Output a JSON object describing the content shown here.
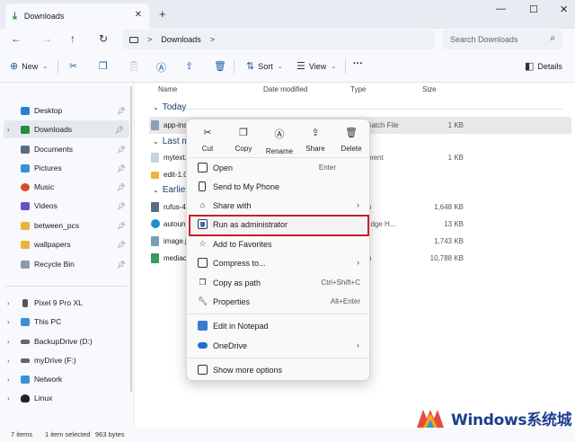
{
  "window": {
    "tab_title": "Downloads",
    "new_tab_glyph": "+",
    "controls": {
      "minimize": "—",
      "maximize": "☐",
      "close": "✕"
    }
  },
  "address": {
    "path": "Downloads",
    "search_placeholder": "Search Downloads"
  },
  "commandbar": {
    "new_label": "New",
    "sort_label": "Sort",
    "view_label": "View",
    "more_glyph": "···",
    "details_label": "Details"
  },
  "sidebar": {
    "quick_access": [
      {
        "label": "Desktop",
        "color": "#2d7dd2"
      },
      {
        "label": "Downloads",
        "color": "#2a8a3a"
      },
      {
        "label": "Documents",
        "color": "#5a6b82"
      },
      {
        "label": "Pictures",
        "color": "#3b8fd9"
      },
      {
        "label": "Music",
        "color": "#d84a2c"
      },
      {
        "label": "Videos",
        "color": "#6b4fc9"
      },
      {
        "label": "between_pcs",
        "color": "#e8b53a"
      },
      {
        "label": "wallpapers",
        "color": "#e8b53a"
      },
      {
        "label": "Recycle Bin",
        "color": "#8a9aab"
      }
    ],
    "devices": [
      {
        "label": "Pixel 9 Pro XL",
        "color": "#555555"
      },
      {
        "label": "This PC",
        "color": "#3b8fd9"
      },
      {
        "label": "BackupDrive (D:)",
        "color": "#666666"
      },
      {
        "label": "myDrive (F:)",
        "color": "#666666"
      },
      {
        "label": "Network",
        "color": "#3b8fd9"
      },
      {
        "label": "Linux",
        "color": "#222222"
      }
    ]
  },
  "filelist": {
    "columns": {
      "name": "Name",
      "date": "Date modified",
      "type": "Type",
      "size": "Size"
    },
    "groups": {
      "today": "Today",
      "last": "Last mor",
      "earlier": "Earlier th"
    },
    "rows": [
      {
        "name": "app-ins",
        "type": "ws Batch File",
        "size": "1 KB",
        "color": "#8aa0b8"
      },
      {
        "name": "mytext.",
        "type": "ocument",
        "size": "1 KB",
        "color": "#c9d3de"
      },
      {
        "name": "edit-1.0",
        "type": "der",
        "size": "",
        "color": "#e8b53a"
      },
      {
        "name": "rufus-4",
        "type": "ation",
        "size": "1,648 KB",
        "color": "#5a6b82"
      },
      {
        "name": "autoun",
        "type": "oft Edge H...",
        "size": "13 KB",
        "color": "#1b8fd2"
      },
      {
        "name": "image.j",
        "type": "",
        "size": "1,743 KB",
        "color": "#7e9bb8"
      },
      {
        "name": "mediac",
        "type": "ation",
        "size": "10,788 KB",
        "color": "#3a9a5a"
      }
    ]
  },
  "context_menu": {
    "quick_actions": [
      "Cut",
      "Copy",
      "Rename",
      "Share",
      "Delete"
    ],
    "items": {
      "open": {
        "label": "Open",
        "key": "Enter"
      },
      "send_phone": {
        "label": "Send to My Phone"
      },
      "share_with": {
        "label": "Share with"
      },
      "run_admin": {
        "label": "Run as administrator"
      },
      "favorites": {
        "label": "Add to Favorites"
      },
      "compress": {
        "label": "Compress to..."
      },
      "copy_path": {
        "label": "Copy as path",
        "key": "Ctrl+Shift+C"
      },
      "properties": {
        "label": "Properties",
        "key": "Alt+Enter"
      },
      "notepad": {
        "label": "Edit in Notepad"
      },
      "onedrive": {
        "label": "OneDrive"
      },
      "more_options": {
        "label": "Show more options"
      }
    }
  },
  "status": {
    "items": "7 items",
    "selected": "1 item selected",
    "size": "963 bytes"
  },
  "watermark": {
    "text": "Windows系统城"
  }
}
